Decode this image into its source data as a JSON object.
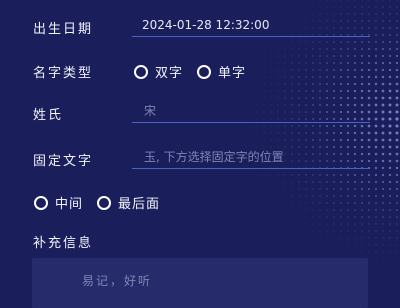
{
  "form": {
    "birth": {
      "label": "出生日期",
      "value": "2024-01-28 12:32:00"
    },
    "name_type": {
      "label": "名字类型",
      "options": [
        {
          "label": "双字"
        },
        {
          "label": "单字"
        }
      ]
    },
    "surname": {
      "label": "姓氏",
      "placeholder": "宋"
    },
    "fixed_char": {
      "label": "固定文字",
      "placeholder": "玉, 下方选择固定字的位置",
      "positions": [
        {
          "label": "中间"
        },
        {
          "label": "最后面"
        }
      ]
    },
    "extra": {
      "label": "补充信息",
      "placeholder": "易记，好听"
    }
  },
  "colors": {
    "background": "#1a1f5c",
    "underline": "#4a62c8",
    "placeholder": "#7f84b6",
    "textarea_bg": "#262c6b"
  }
}
